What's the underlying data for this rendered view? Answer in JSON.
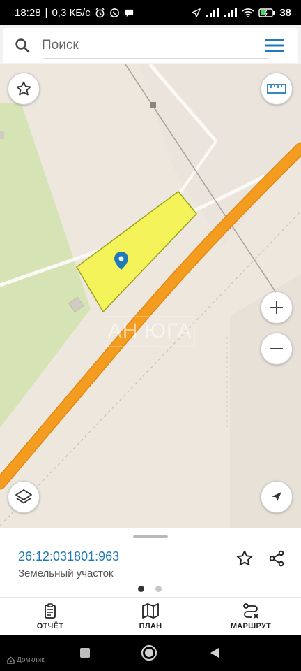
{
  "status_bar": {
    "time": "18:28",
    "speed": "0,3 КБ/с",
    "battery": "38"
  },
  "search": {
    "placeholder": "Поиск"
  },
  "map": {
    "watermark": "АН ЮГА"
  },
  "parcel": {
    "cadastral_number": "26:12:031801:963",
    "type": "Земельный участок"
  },
  "tabs": [
    {
      "label": "ОТЧЁТ",
      "icon": "report-icon"
    },
    {
      "label": "ПЛАН",
      "icon": "map-plan-icon"
    },
    {
      "label": "МАРШРУТ",
      "icon": "route-icon"
    }
  ],
  "footer": {
    "brand": "Домклик"
  },
  "colors": {
    "accent": "#1f7ab8",
    "road": "#f39c1f",
    "parcel_fill": "#f5f35a",
    "parcel_stroke": "#9aa31a",
    "green_area": "#d6e3b5",
    "map_bg": "#ede7de"
  },
  "pagination": {
    "pages": 2,
    "active": 1
  }
}
